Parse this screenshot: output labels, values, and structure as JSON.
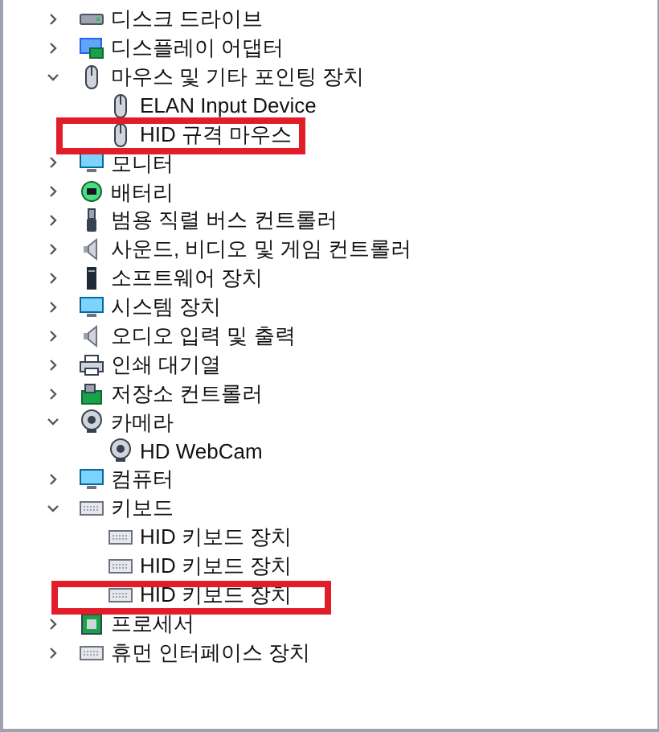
{
  "devices": [
    {
      "label": "디스크 드라이브",
      "expanded": false
    },
    {
      "label": "디스플레이 어댑터",
      "expanded": false
    },
    {
      "label": "마우스 및 기타 포인팅 장치",
      "expanded": true,
      "children": [
        {
          "label": "ELAN Input Device"
        },
        {
          "label": "HID 규격 마우스"
        }
      ]
    },
    {
      "label": "모니터",
      "expanded": false
    },
    {
      "label": "배터리",
      "expanded": false
    },
    {
      "label": "범용 직렬 버스 컨트롤러",
      "expanded": false
    },
    {
      "label": "사운드, 비디오 및 게임 컨트롤러",
      "expanded": false
    },
    {
      "label": "소프트웨어 장치",
      "expanded": false
    },
    {
      "label": "시스템 장치",
      "expanded": false
    },
    {
      "label": "오디오 입력 및 출력",
      "expanded": false
    },
    {
      "label": "인쇄 대기열",
      "expanded": false
    },
    {
      "label": "저장소 컨트롤러",
      "expanded": false
    },
    {
      "label": "카메라",
      "expanded": true,
      "children": [
        {
          "label": "HD WebCam"
        }
      ]
    },
    {
      "label": "컴퓨터",
      "expanded": false
    },
    {
      "label": "키보드",
      "expanded": true,
      "children": [
        {
          "label": "HID 키보드 장치"
        },
        {
          "label": "HID 키보드 장치"
        },
        {
          "label": "HID 키보드 장치"
        }
      ]
    },
    {
      "label": "프로세서",
      "expanded": false
    },
    {
      "label": "휴먼 인터페이스 장치",
      "expanded": false
    }
  ]
}
